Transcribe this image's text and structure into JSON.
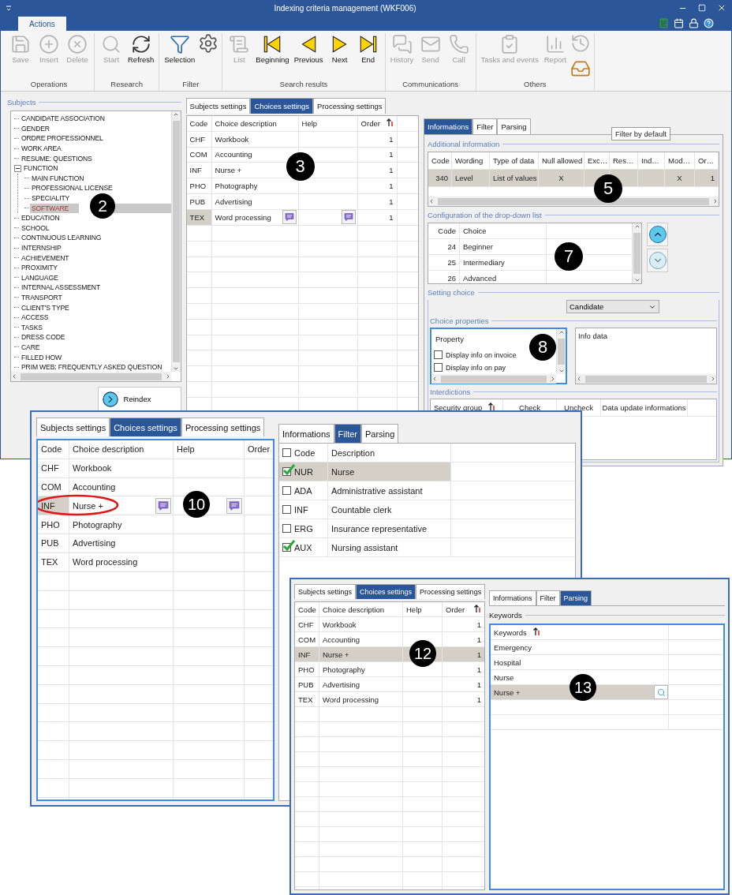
{
  "window": {
    "title": "Indexing criteria management (WKF006)"
  },
  "ribbon": {
    "tabs": [
      {
        "label": "Actions",
        "selected": true
      }
    ],
    "groups": [
      {
        "label": "Operations",
        "buttons": [
          {
            "label": "Save",
            "disabled": true
          },
          {
            "label": "Insert",
            "disabled": true
          },
          {
            "label": "Delete",
            "disabled": true
          }
        ]
      },
      {
        "label": "Research",
        "buttons": [
          {
            "label": "Start",
            "disabled": true
          },
          {
            "label": "Refresh",
            "disabled": false
          }
        ]
      },
      {
        "label": "Filter",
        "buttons": [
          {
            "label": "Selection",
            "disabled": false
          },
          {
            "disabled": false
          }
        ]
      },
      {
        "label": "Search results",
        "buttons": [
          {
            "label": "List",
            "disabled": true
          },
          {
            "label": "Beginning",
            "disabled": false
          },
          {
            "label": "Previous",
            "disabled": false
          },
          {
            "label": "Next",
            "disabled": false
          },
          {
            "label": "End",
            "disabled": false
          }
        ]
      },
      {
        "label": "Communications",
        "buttons": [
          {
            "label": "History",
            "disabled": true
          },
          {
            "label": "Send",
            "disabled": true
          },
          {
            "label": "Call",
            "disabled": true
          }
        ]
      },
      {
        "label": "Others",
        "buttons": [
          {
            "label": "Tasks and events",
            "disabled": true
          },
          {
            "label": "Report",
            "disabled": true
          },
          {
            "disabled": true
          },
          {
            "disabled": false
          }
        ]
      }
    ]
  },
  "subjects": {
    "title": "Subjects",
    "callout": "2",
    "reindex_button": "Reindex",
    "items": [
      {
        "label": "CANDIDATE ASSOCIATION",
        "selected": false
      },
      {
        "label": "GENDER",
        "selected": false
      },
      {
        "label": "ORDRE PROFESSIONNEL",
        "selected": false
      },
      {
        "label": "WORK AREA",
        "selected": false
      },
      {
        "label": "RESUME: QUESTIONS",
        "selected": false
      },
      {
        "label": "FUNCTION",
        "selected": false,
        "expanded": true,
        "children": [
          {
            "label": "MAIN FUNCTION",
            "selected": false
          },
          {
            "label": "PROFESSIONAL LICENSE",
            "selected": false
          },
          {
            "label": "SPECIALITY",
            "selected": false
          },
          {
            "label": "SOFTWARE",
            "selected": true
          }
        ]
      },
      {
        "label": "EDUCATION",
        "selected": false
      },
      {
        "label": "SCHOOL",
        "selected": false
      },
      {
        "label": "CONTINUOUS LEARNING",
        "selected": false
      },
      {
        "label": "INTERNSHIP",
        "selected": false
      },
      {
        "label": "ACHIEVEMENT",
        "selected": false
      },
      {
        "label": "PROXIMITY",
        "selected": false
      },
      {
        "label": "LANGUAGE",
        "selected": false
      },
      {
        "label": "INTERNAL ASSESSMENT",
        "selected": false
      },
      {
        "label": "TRANSPORT",
        "selected": false
      },
      {
        "label": "CLIENT'S TYPE",
        "selected": false
      },
      {
        "label": "ACCESS",
        "selected": false
      },
      {
        "label": "TASKS",
        "selected": false
      },
      {
        "label": "DRESS CODE",
        "selected": false
      },
      {
        "label": "CARE",
        "selected": false
      },
      {
        "label": "FILLED HOW",
        "selected": false
      },
      {
        "label": "PRIM WEB: FREQUENTLY ASKED QUESTION",
        "selected": false
      }
    ]
  },
  "choices": {
    "callout": "3",
    "tabs": [
      {
        "label": "Subjects settings",
        "selected": false
      },
      {
        "label": "Choices settings",
        "selected": true
      },
      {
        "label": "Processing settings",
        "selected": false
      }
    ],
    "columns": [
      "Code",
      "Choice description",
      "Help",
      "Order"
    ],
    "rows": [
      {
        "code": "CHF",
        "description": "Workbook",
        "order": "1",
        "selected": false,
        "editing": false
      },
      {
        "code": "COM",
        "description": "Accounting",
        "order": "1",
        "selected": false,
        "editing": false
      },
      {
        "code": "INF",
        "description": "Nurse +",
        "order": "1",
        "selected": false,
        "editing": false
      },
      {
        "code": "PHO",
        "description": "Photography",
        "order": "1",
        "selected": false,
        "editing": false
      },
      {
        "code": "PUB",
        "description": "Advertising",
        "order": "1",
        "selected": false,
        "editing": false
      },
      {
        "code": "TEX",
        "description": "Word processing",
        "order": "1",
        "selected": true,
        "editing": true
      }
    ]
  },
  "details": {
    "tabs": [
      {
        "label": "Informations",
        "selected": true
      },
      {
        "label": "Filter",
        "selected": false
      },
      {
        "label": "Parsing",
        "selected": false
      }
    ],
    "additional_information": {
      "title": "Additional information",
      "tooltip": "Filter by default",
      "callout": "5",
      "columns": [
        "Code",
        "Wording",
        "Type of data",
        "Null allowed",
        "Exc…",
        "Res…",
        "Ind…",
        "Mod…",
        "Or…"
      ],
      "rows": [
        {
          "cells": [
            "340",
            "Level",
            "List of values",
            "X",
            "",
            "",
            "",
            "X",
            "1"
          ],
          "selected": true
        }
      ]
    },
    "dropdown_list": {
      "title": "Configuration of the drop-down list",
      "callout": "7",
      "columns": [
        "Code",
        "Choice"
      ],
      "rows": [
        {
          "code": "24",
          "choice": "Beginner"
        },
        {
          "code": "25",
          "choice": "Intermediary"
        },
        {
          "code": "26",
          "choice": "Advanced"
        }
      ],
      "move_up": {
        "disabled": false
      },
      "move_down": {
        "disabled": true
      }
    },
    "setting_choice": {
      "title": "Setting choice",
      "value": "Candidate"
    },
    "choice_properties": {
      "title": "Choice properties",
      "callout": "8",
      "property_header": "Property",
      "properties": [
        {
          "label": "Display info on invoice",
          "checked": false
        },
        {
          "label": "Display info on pay",
          "checked": false
        }
      ],
      "info_header": "Info data"
    },
    "interdictions": {
      "title": "Interdictions",
      "columns": [
        "Security group",
        "Check",
        "Uncheck",
        "Data update informations"
      ]
    }
  },
  "overlay_filter": {
    "callout": "10",
    "tabs": [
      {
        "label": "Subjects settings",
        "selected": false
      },
      {
        "label": "Choices settings",
        "selected": true
      },
      {
        "label": "Processing settings",
        "selected": false
      }
    ],
    "choices": {
      "columns": [
        "Code",
        "Choice description",
        "Help",
        "Order"
      ],
      "rows": [
        {
          "code": "CHF",
          "description": "Workbook",
          "selected": false,
          "editing": false,
          "circled": false
        },
        {
          "code": "COM",
          "description": "Accounting",
          "selected": false,
          "editing": false,
          "circled": false
        },
        {
          "code": "INF",
          "description": "Nurse +",
          "selected": true,
          "editing": true,
          "circled": true
        },
        {
          "code": "PHO",
          "description": "Photography",
          "selected": false,
          "editing": false,
          "circled": false
        },
        {
          "code": "PUB",
          "description": "Advertising",
          "selected": false,
          "editing": false,
          "circled": false
        },
        {
          "code": "TEX",
          "description": "Word processing",
          "selected": false,
          "editing": false,
          "circled": false
        }
      ]
    },
    "detail_tabs": [
      {
        "label": "Informations",
        "selected": false
      },
      {
        "label": "Filter",
        "selected": true
      },
      {
        "label": "Parsing",
        "selected": false
      }
    ],
    "filter": {
      "columns": [
        "Code",
        "Description"
      ],
      "all_checked": false,
      "rows": [
        {
          "code": "NUR",
          "description": "Nurse",
          "checked": true,
          "selected": true
        },
        {
          "code": "ADA",
          "description": "Administrative assistant",
          "checked": false,
          "selected": false
        },
        {
          "code": "INF",
          "description": "Countable clerk",
          "checked": false,
          "selected": false
        },
        {
          "code": "ERG",
          "description": "Insurance representative",
          "checked": false,
          "selected": false
        },
        {
          "code": "AUX",
          "description": "Nursing assistant",
          "checked": true,
          "selected": false
        }
      ]
    }
  },
  "overlay_parsing": {
    "callouts": [
      "12",
      "13"
    ],
    "tabs": [
      {
        "label": "Subjects settings",
        "selected": false
      },
      {
        "label": "Choices settings",
        "selected": true
      },
      {
        "label": "Processing settings",
        "selected": false
      }
    ],
    "choices": {
      "columns": [
        "Code",
        "Choice description",
        "Help",
        "Order"
      ],
      "rows": [
        {
          "code": "CHF",
          "description": "Workbook",
          "order": "1",
          "selected": false,
          "editing": false
        },
        {
          "code": "COM",
          "description": "Accounting",
          "order": "1",
          "selected": false,
          "editing": false
        },
        {
          "code": "INF",
          "description": "Nurse +",
          "order": "1",
          "selected": true,
          "editing": false
        },
        {
          "code": "PHO",
          "description": "Photography",
          "order": "1",
          "selected": false,
          "editing": false
        },
        {
          "code": "PUB",
          "description": "Advertising",
          "order": "1",
          "selected": false,
          "editing": false
        },
        {
          "code": "TEX",
          "description": "Word processing",
          "order": "1",
          "selected": false,
          "editing": false
        }
      ]
    },
    "detail_tabs": [
      {
        "label": "Informations",
        "selected": false
      },
      {
        "label": "Filter",
        "selected": false
      },
      {
        "label": "Parsing",
        "selected": true
      }
    ],
    "keywords": {
      "title": "Keywords",
      "column": "Keywords",
      "rows": [
        {
          "label": "Emergency",
          "selected": false
        },
        {
          "label": "Hospital",
          "selected": false
        },
        {
          "label": "Nurse",
          "selected": false
        },
        {
          "label": "Nurse +",
          "selected": true
        }
      ]
    }
  }
}
